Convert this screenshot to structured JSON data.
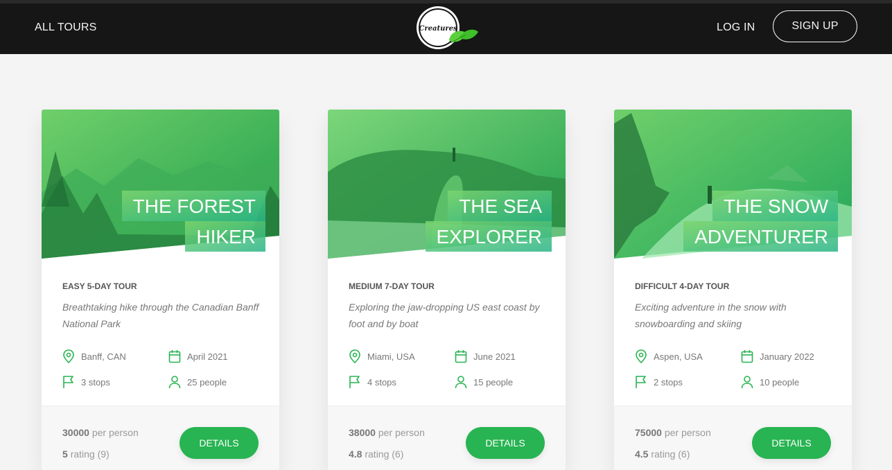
{
  "nav": {
    "all_tours": "ALL TOURS",
    "logo_text": "Creatures",
    "login": "LOG IN",
    "signup": "SIGN UP"
  },
  "colors": {
    "accent": "#28b452",
    "header_bg": "#161616",
    "page_bg": "#f4f4f4"
  },
  "tours": [
    {
      "title_line1": "THE FOREST",
      "title_line2": "HIKER",
      "subheading": "EASY 5-DAY TOUR",
      "summary": "Breathtaking hike through the Canadian Banff National Park",
      "location": "Banff, CAN",
      "date": "April 2021",
      "stops": "3 stops",
      "people": "25 people",
      "price": "30000",
      "price_unit": "per person",
      "rating": "5",
      "rating_label": "rating (9)",
      "button": "DETAILS"
    },
    {
      "title_line1": "THE SEA",
      "title_line2": "EXPLORER",
      "subheading": "MEDIUM 7-DAY TOUR",
      "summary": "Exploring the jaw-dropping US east coast by foot and by boat",
      "location": "Miami, USA",
      "date": "June 2021",
      "stops": "4 stops",
      "people": "15 people",
      "price": "38000",
      "price_unit": "per person",
      "rating": "4.8",
      "rating_label": "rating (6)",
      "button": "DETAILS"
    },
    {
      "title_line1": "THE SNOW",
      "title_line2": "ADVENTURER",
      "subheading": "DIFFICULT 4-DAY TOUR",
      "summary": "Exciting adventure in the snow with snowboarding and skiing",
      "location": "Aspen, USA",
      "date": "January 2022",
      "stops": "2 stops",
      "people": "10 people",
      "price": "75000",
      "price_unit": "per person",
      "rating": "4.5",
      "rating_label": "rating (6)",
      "button": "DETAILS"
    }
  ]
}
